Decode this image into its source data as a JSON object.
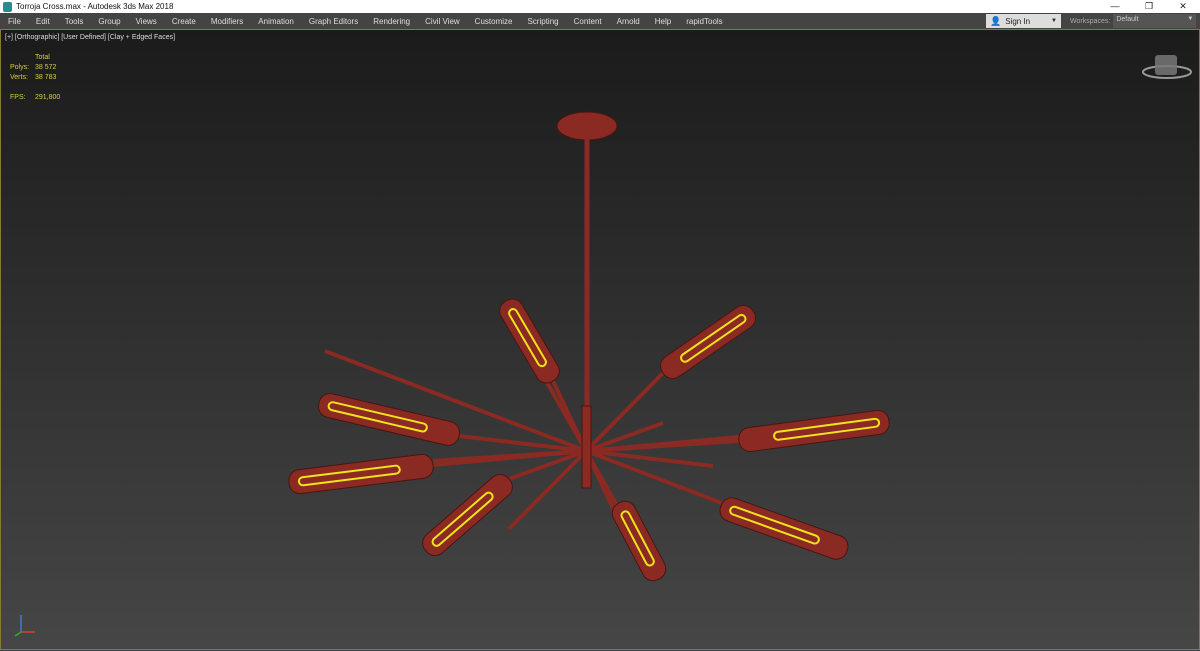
{
  "window": {
    "title": "Torroja Cross.max - Autodesk 3ds Max 2018",
    "min": "—",
    "restore": "❐",
    "close": "✕"
  },
  "menu": [
    "File",
    "Edit",
    "Tools",
    "Group",
    "Views",
    "Create",
    "Modifiers",
    "Animation",
    "Graph Editors",
    "Rendering",
    "Civil View",
    "Customize",
    "Scripting",
    "Content",
    "Arnold",
    "Help",
    "rapidTools"
  ],
  "signin": {
    "label": "Sign In",
    "arrow": "▼"
  },
  "workspaces": {
    "label": "Workspaces:",
    "value": "Default",
    "arrow": "▼"
  },
  "viewport": {
    "label": "[+] [Orthographic] [User Defined] [Clay + Edged Faces]",
    "stats": {
      "header": "Total",
      "polys_label": "Polys:",
      "polys": "38 572",
      "verts_label": "Verts:",
      "verts": "38 783",
      "fps_label": "FPS:",
      "fps": "291,800"
    }
  },
  "colors": {
    "model": "#8a2a22",
    "filament": "#f2e21a",
    "stats": "#d6cf3f"
  }
}
